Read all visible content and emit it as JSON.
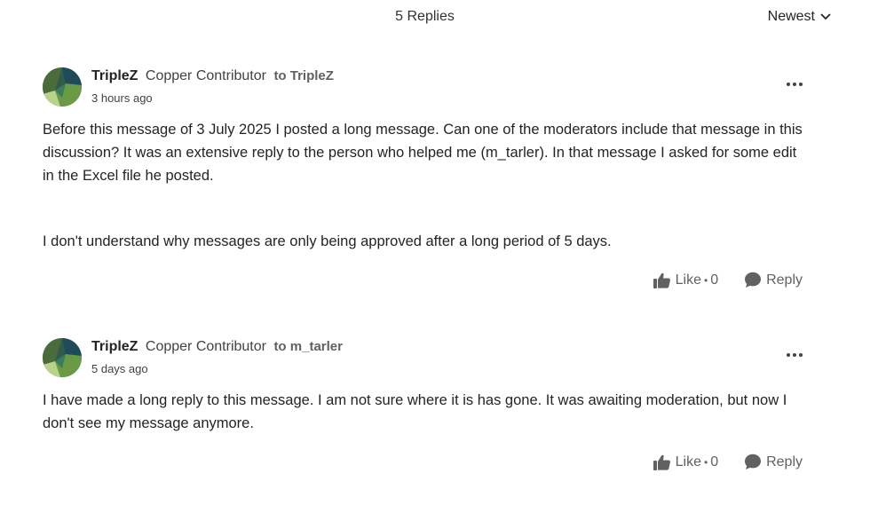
{
  "thread": {
    "replies_count": "5 Replies",
    "sort_label": "Newest"
  },
  "messages": [
    {
      "author": "TripleZ",
      "rank": "Copper Contributor",
      "reply_to": "to TripleZ",
      "timestamp": "3 hours ago",
      "paragraphs": [
        "Before this message of 3 July 2025 I posted a long message. Can one of the moderators include that message in this discussion? It was an extensive reply to the person who helped me (m_tarler). In that message I asked for some edit in the Excel file he posted.",
        "I don't understand why messages are only being approved after a long period of 5 days."
      ],
      "like_label": "Like",
      "like_count": "0",
      "reply_label": "Reply"
    },
    {
      "author": "TripleZ",
      "rank": "Copper Contributor",
      "reply_to": "to m_tarler",
      "timestamp": "5 days ago",
      "paragraphs": [
        "I have made a long reply to this message. I am not sure where it is has gone. It was awaiting moderation, but now I don't see my message anymore."
      ],
      "like_label": "Like",
      "like_count": "0",
      "reply_label": "Reply"
    }
  ],
  "icons": {
    "sort": "chevron-down-icon",
    "more": "more-horizontal-icon",
    "like": "thumbs-up-icon",
    "reply": "chat-bubble-icon"
  },
  "colors": {
    "text_primary": "#242424",
    "text_secondary": "#616161",
    "avatar_dark": "#2f5a4e",
    "avatar_green": "#6a9a45",
    "avatar_light": "#b8d48a"
  }
}
